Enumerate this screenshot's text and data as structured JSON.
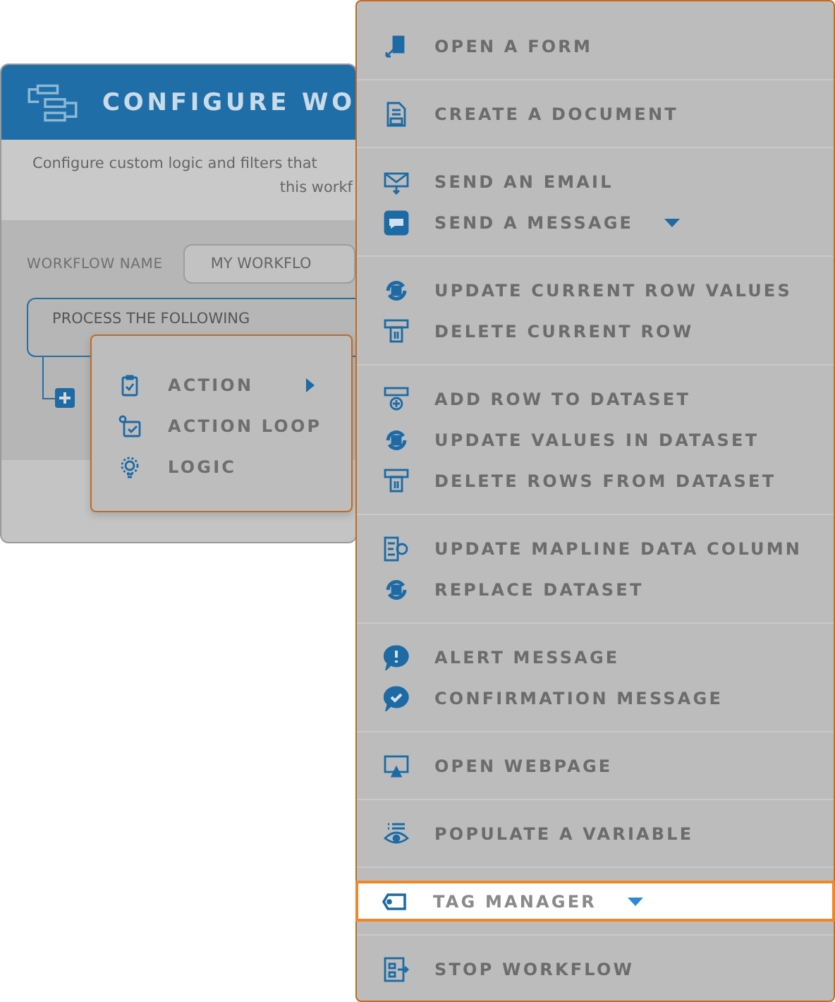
{
  "dialog": {
    "title": "CONFIGURE WO",
    "description": [
      "Configure custom logic and filters that",
      "this workf"
    ],
    "name_label": "WORKFLOW NAME",
    "name_value": "MY WORKFLO",
    "step": "PROCESS THE FOLLOWING"
  },
  "popover": {
    "items": [
      {
        "label": "ACTION",
        "submenu": true
      },
      {
        "label": "ACTION LOOP",
        "submenu": false
      },
      {
        "label": "LOGIC",
        "submenu": false
      }
    ]
  },
  "menu": {
    "groups": [
      {
        "items": [
          {
            "label": "OPEN A FORM",
            "dropdown": false,
            "selected": false
          }
        ]
      },
      {
        "items": [
          {
            "label": "CREATE A DOCUMENT",
            "dropdown": false,
            "selected": false
          }
        ]
      },
      {
        "items": [
          {
            "label": "SEND AN EMAIL",
            "dropdown": false,
            "selected": false
          },
          {
            "label": "SEND A MESSAGE",
            "dropdown": true,
            "selected": false
          }
        ]
      },
      {
        "items": [
          {
            "label": "UPDATE CURRENT ROW VALUES",
            "dropdown": false,
            "selected": false
          },
          {
            "label": "DELETE CURRENT ROW",
            "dropdown": false,
            "selected": false
          }
        ]
      },
      {
        "items": [
          {
            "label": "ADD ROW TO DATASET",
            "dropdown": false,
            "selected": false
          },
          {
            "label": "UPDATE VALUES IN DATASET",
            "dropdown": false,
            "selected": false
          },
          {
            "label": "DELETE ROWS FROM DATASET",
            "dropdown": false,
            "selected": false
          }
        ]
      },
      {
        "items": [
          {
            "label": "UPDATE MAPLINE DATA COLUMN",
            "dropdown": false,
            "selected": false
          },
          {
            "label": "REPLACE DATASET",
            "dropdown": false,
            "selected": false
          }
        ]
      },
      {
        "items": [
          {
            "label": "ALERT MESSAGE",
            "dropdown": false,
            "selected": false
          },
          {
            "label": "CONFIRMATION MESSAGE",
            "dropdown": false,
            "selected": false
          }
        ]
      },
      {
        "items": [
          {
            "label": "OPEN WEBPAGE",
            "dropdown": false,
            "selected": false
          }
        ]
      },
      {
        "items": [
          {
            "label": "POPULATE A VARIABLE",
            "dropdown": false,
            "selected": false
          }
        ]
      },
      {
        "items": [
          {
            "label": "TAG MANAGER",
            "dropdown": true,
            "selected": true
          }
        ]
      },
      {
        "items": [
          {
            "label": "STOP WORKFLOW",
            "dropdown": false,
            "selected": false
          }
        ]
      }
    ]
  }
}
